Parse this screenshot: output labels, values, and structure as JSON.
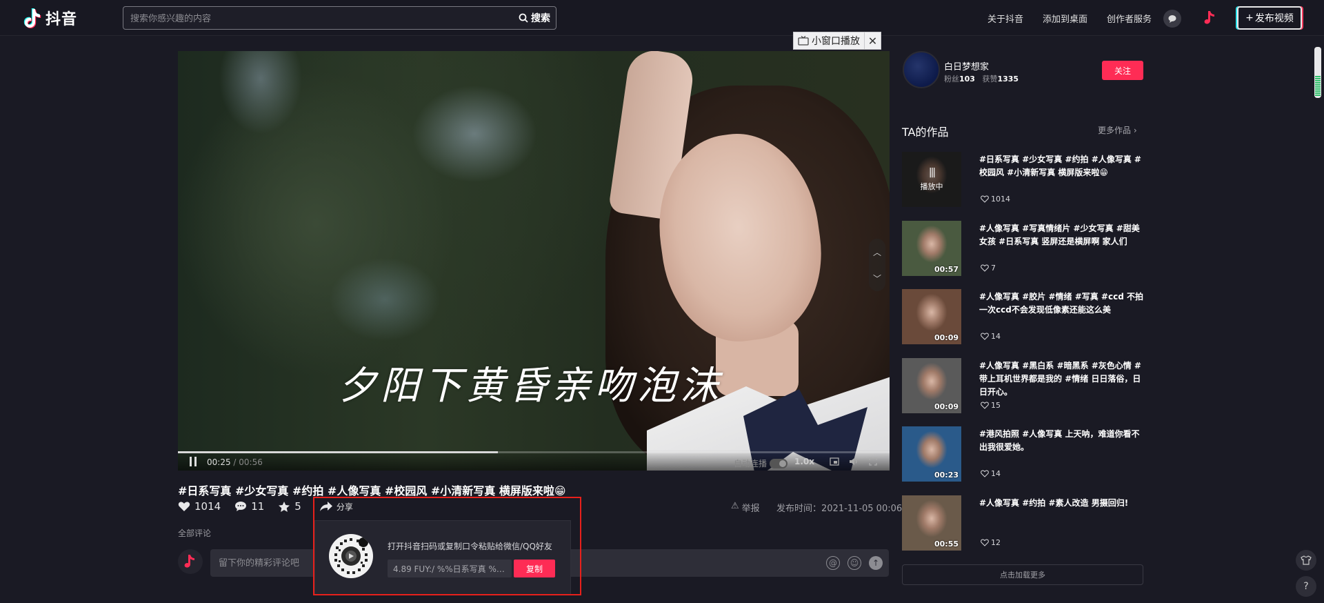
{
  "header": {
    "logo_text": "抖音",
    "search_placeholder": "搜索你感兴趣的内容",
    "search_button": "搜索",
    "nav": [
      "关于抖音",
      "添加到桌面",
      "创作者服务"
    ],
    "publish_button": "发布视频"
  },
  "mini_player": {
    "label": "小窗口播放"
  },
  "video": {
    "subtitle": "夕阳下黄昏亲吻泡沫",
    "current_time": "00:25",
    "duration": "00:56",
    "progress": 0.45,
    "autoplay_label": "自动连播",
    "speed": "1.0x"
  },
  "post": {
    "title": "#日系写真 #少女写真 #约拍 #人像写真 #校园风 #小清新写真 横屏版来啦😁",
    "likes": "1014",
    "comments": "11",
    "favorites": "5",
    "share_label": "分享",
    "report_label": "举报",
    "publish_time": "发布时间：2021-11-05 00:06"
  },
  "comments": {
    "label": "全部评论",
    "placeholder": "留下你的精彩评论吧"
  },
  "share_popup": {
    "text": "打开抖音扫码或复制口令粘贴给微信/QQ好友",
    "code": "4.89 FUY:/ %%日系写真 %少女写真",
    "copy_button": "复制"
  },
  "author": {
    "name": "白日梦想家",
    "fans_label": "粉丝",
    "fans": "103",
    "likes_label": "获赞",
    "likes": "1335",
    "follow_button": "关注"
  },
  "works": {
    "title": "TA的作品",
    "more": "更多作品",
    "playing_label": "播放中",
    "items": [
      {
        "title": "#日系写真 #少女写真 #约拍 #人像写真 #校园风 #小清新写真 横屏版来啦😁",
        "likes": "1014",
        "duration": "",
        "playing": true,
        "thumb_color": "#3a3a3a"
      },
      {
        "title": "#人像写真 #写真情绪片 #少女写真 #甜美女孩 #日系写真 竖屏还是横屏啊 家人们",
        "likes": "7",
        "duration": "00:57",
        "playing": false,
        "thumb_color": "#4a5a40"
      },
      {
        "title": "#人像写真 #胶片 #情绪 #写真 #ccd 不拍一次ccd不会发现低像素还能这么美",
        "likes": "14",
        "duration": "00:09",
        "playing": false,
        "thumb_color": "#6a4a3a"
      },
      {
        "title": "#人像写真 #黑白系 #暗黑系 #灰色心情 #带上耳机世界都是我的 #情绪 日日落俗，日日开心。",
        "likes": "15",
        "duration": "00:09",
        "playing": false,
        "thumb_color": "#5a5a5a"
      },
      {
        "title": "#港风拍照 #人像写真 上天呐，难道你看不出我很爱她。",
        "likes": "14",
        "duration": "00:23",
        "playing": false,
        "thumb_color": "#2a5a8a"
      },
      {
        "title": "#人像写真 #约拍 #素人改造 男摄回归!",
        "likes": "12",
        "duration": "00:55",
        "playing": false,
        "thumb_color": "#6a5a4a"
      }
    ],
    "load_more": "点击加载更多"
  }
}
